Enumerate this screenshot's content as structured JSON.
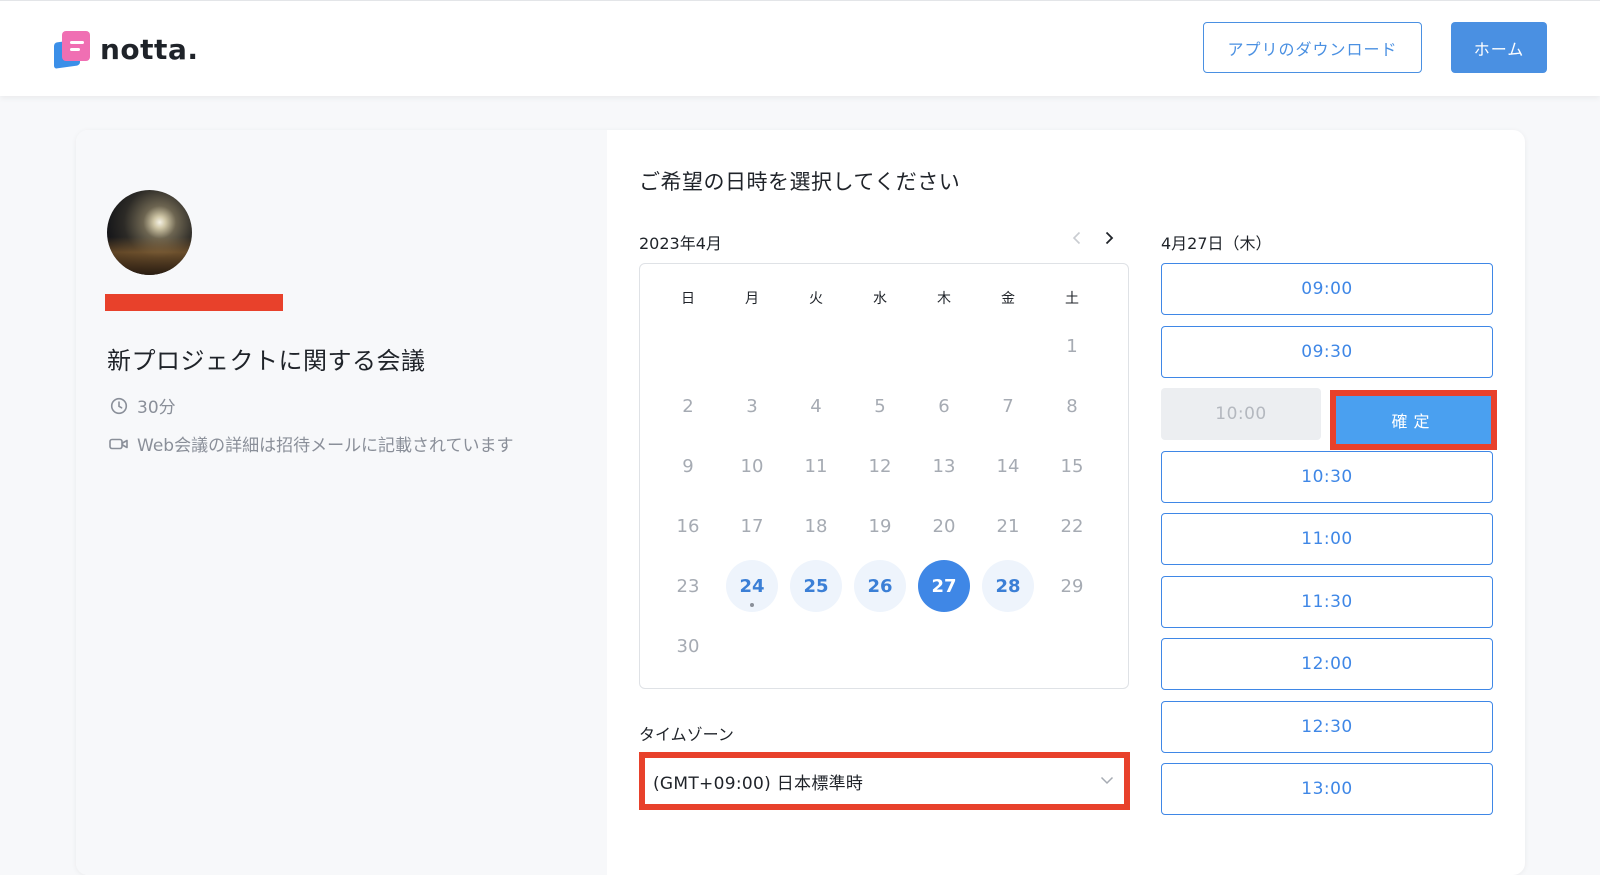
{
  "header": {
    "logo_text": "notta.",
    "download_label": "アプリのダウンロード",
    "home_label": "ホーム"
  },
  "left": {
    "meeting_title": "新プロジェクトに関する会議",
    "duration": "30分",
    "location_note": "Web会議の詳細は招待メールに記載されています",
    "clock_icon": "clock-icon",
    "video_icon": "video-camera-icon"
  },
  "scheduler": {
    "heading": "ご希望の日時を選択してください",
    "month_label": "2023年4月",
    "weekdays": [
      "日",
      "月",
      "火",
      "水",
      "木",
      "金",
      "土"
    ],
    "weeks": [
      [
        "",
        "",
        "",
        "",
        "",
        "",
        "1"
      ],
      [
        "2",
        "3",
        "4",
        "5",
        "6",
        "7",
        "8"
      ],
      [
        "9",
        "10",
        "11",
        "12",
        "13",
        "14",
        "15"
      ],
      [
        "16",
        "17",
        "18",
        "19",
        "20",
        "21",
        "22"
      ],
      [
        "23",
        "24",
        "25",
        "26",
        "27",
        "28",
        "29"
      ],
      [
        "30",
        "",
        "",
        "",
        "",
        "",
        ""
      ]
    ],
    "available_days": [
      "24",
      "25",
      "26",
      "27",
      "28"
    ],
    "selected_day": "27",
    "today": "24",
    "timezone_label": "タイムゾーン",
    "timezone_value": "(GMT+09:00) 日本標準時"
  },
  "slots": {
    "date_heading": "4月27日（木）",
    "times": [
      "09:00",
      "09:30",
      "10:00",
      "10:30",
      "11:00",
      "11:30",
      "12:00",
      "12:30",
      "13:00"
    ],
    "pending_time": "10:00",
    "confirm_label": "確定"
  },
  "colors": {
    "accent": "#3f87e6",
    "highlight_red": "#e8412b",
    "confirm_blue": "#4aa0f0"
  }
}
